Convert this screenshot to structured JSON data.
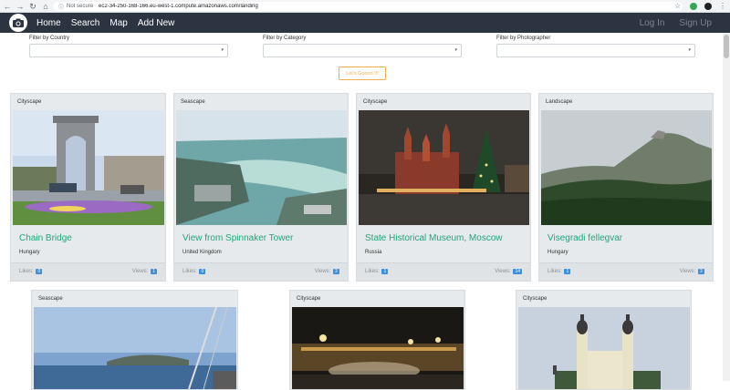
{
  "browser": {
    "security_label": "Not secure",
    "url": "ec2-34-250-168-166.eu-west-1.compute.amazonaws.com/landing"
  },
  "navbar": {
    "links": [
      "Home",
      "Search",
      "Map",
      "Add New"
    ],
    "login": "Log In",
    "signup": "Sign Up"
  },
  "filters": {
    "country_label": "Filter by Country",
    "category_label": "Filter by Category",
    "photographer_label": "Filter by Photographer",
    "go_button": "Let's Goooo !!!"
  },
  "cards_row1": [
    {
      "category": "Cityscape",
      "title": "Chain Bridge",
      "country": "Hungary",
      "likes_label": "Likes:",
      "likes": "0",
      "views_label": "Views:",
      "views": "1"
    },
    {
      "category": "Seascape",
      "title": "View from Spinnaker Tower",
      "country": "United Kingdom",
      "likes_label": "Likes:",
      "likes": "0",
      "views_label": "Views:",
      "views": "2"
    },
    {
      "category": "Cityscape",
      "title": "State Historical Museum, Moscow",
      "country": "Russia",
      "likes_label": "Likes:",
      "likes": "1",
      "views_label": "Views:",
      "views": "14"
    },
    {
      "category": "Landscape",
      "title": "Visegradi fellegvar",
      "country": "Hungary",
      "likes_label": "Likes:",
      "likes": "1",
      "views_label": "Views:",
      "views": "2"
    }
  ],
  "cards_row2": [
    {
      "category": "Seascape"
    },
    {
      "category": "Cityscape"
    },
    {
      "category": "Cityscape"
    }
  ]
}
